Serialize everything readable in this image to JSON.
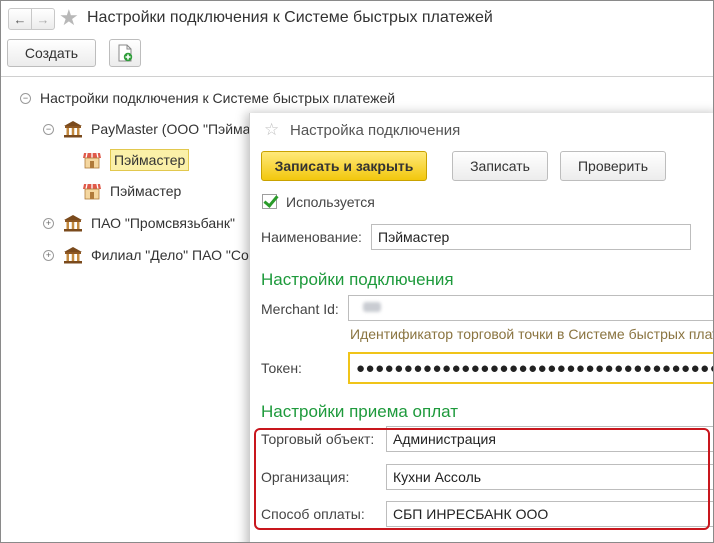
{
  "header": {
    "title": "Настройки подключения к Системе быстрых платежей",
    "back_icon": "arrow-left-icon",
    "forward_icon": "arrow-right-icon",
    "favorite_icon": "star-icon"
  },
  "toolbar": {
    "create_label": "Создать",
    "add_doc_icon": "document-add-icon"
  },
  "tree": {
    "root_label": "Настройки подключения к Системе быстрых платежей",
    "items": [
      {
        "label": "PayMaster (ООО \"Пэймастер\")",
        "icon": "bank-icon",
        "expanded": true
      },
      {
        "label": "Пэймастер",
        "icon": "shop-icon",
        "selected": true
      },
      {
        "label": "Пэймастер",
        "icon": "shop-icon"
      },
      {
        "label": "ПАО \"Промсвязьбанк\"",
        "icon": "bank-icon",
        "expanded": false
      },
      {
        "label": "Филиал \"Дело\" ПАО \"Совкомбанк\"",
        "icon": "bank-icon",
        "expanded": false
      }
    ]
  },
  "dialog": {
    "title": "Настройка подключения",
    "save_close_label": "Записать и закрыть",
    "save_label": "Записать",
    "check_label": "Проверить",
    "used_label": "Используется",
    "used_checked": true,
    "name_label": "Наименование:",
    "name_value": "Пэймастер",
    "connection_section": "Настройки подключения",
    "merchant_label": "Merchant Id:",
    "merchant_hint": "Идентификатор торговой точки в Системе быстрых платежей",
    "token_label": "Токен:",
    "token_value": "●●●●●●●●●●●●●●●●●●●●●●●●●●●●●●●●●●●●●●",
    "payments_section": "Настройки приема оплат",
    "trade_object_label": "Торговый объект:",
    "trade_object_value": "Администрация",
    "organization_label": "Организация:",
    "organization_value": "Кухни Ассоль",
    "payment_method_label": "Способ оплаты:",
    "payment_method_value": "СБП ИНРЕСБАНК ООО"
  },
  "colors": {
    "accent_green": "#1e9a3c",
    "primary_button": "#f2c70d",
    "highlight_red": "#c8161d",
    "selection": "#fbf0a8"
  }
}
